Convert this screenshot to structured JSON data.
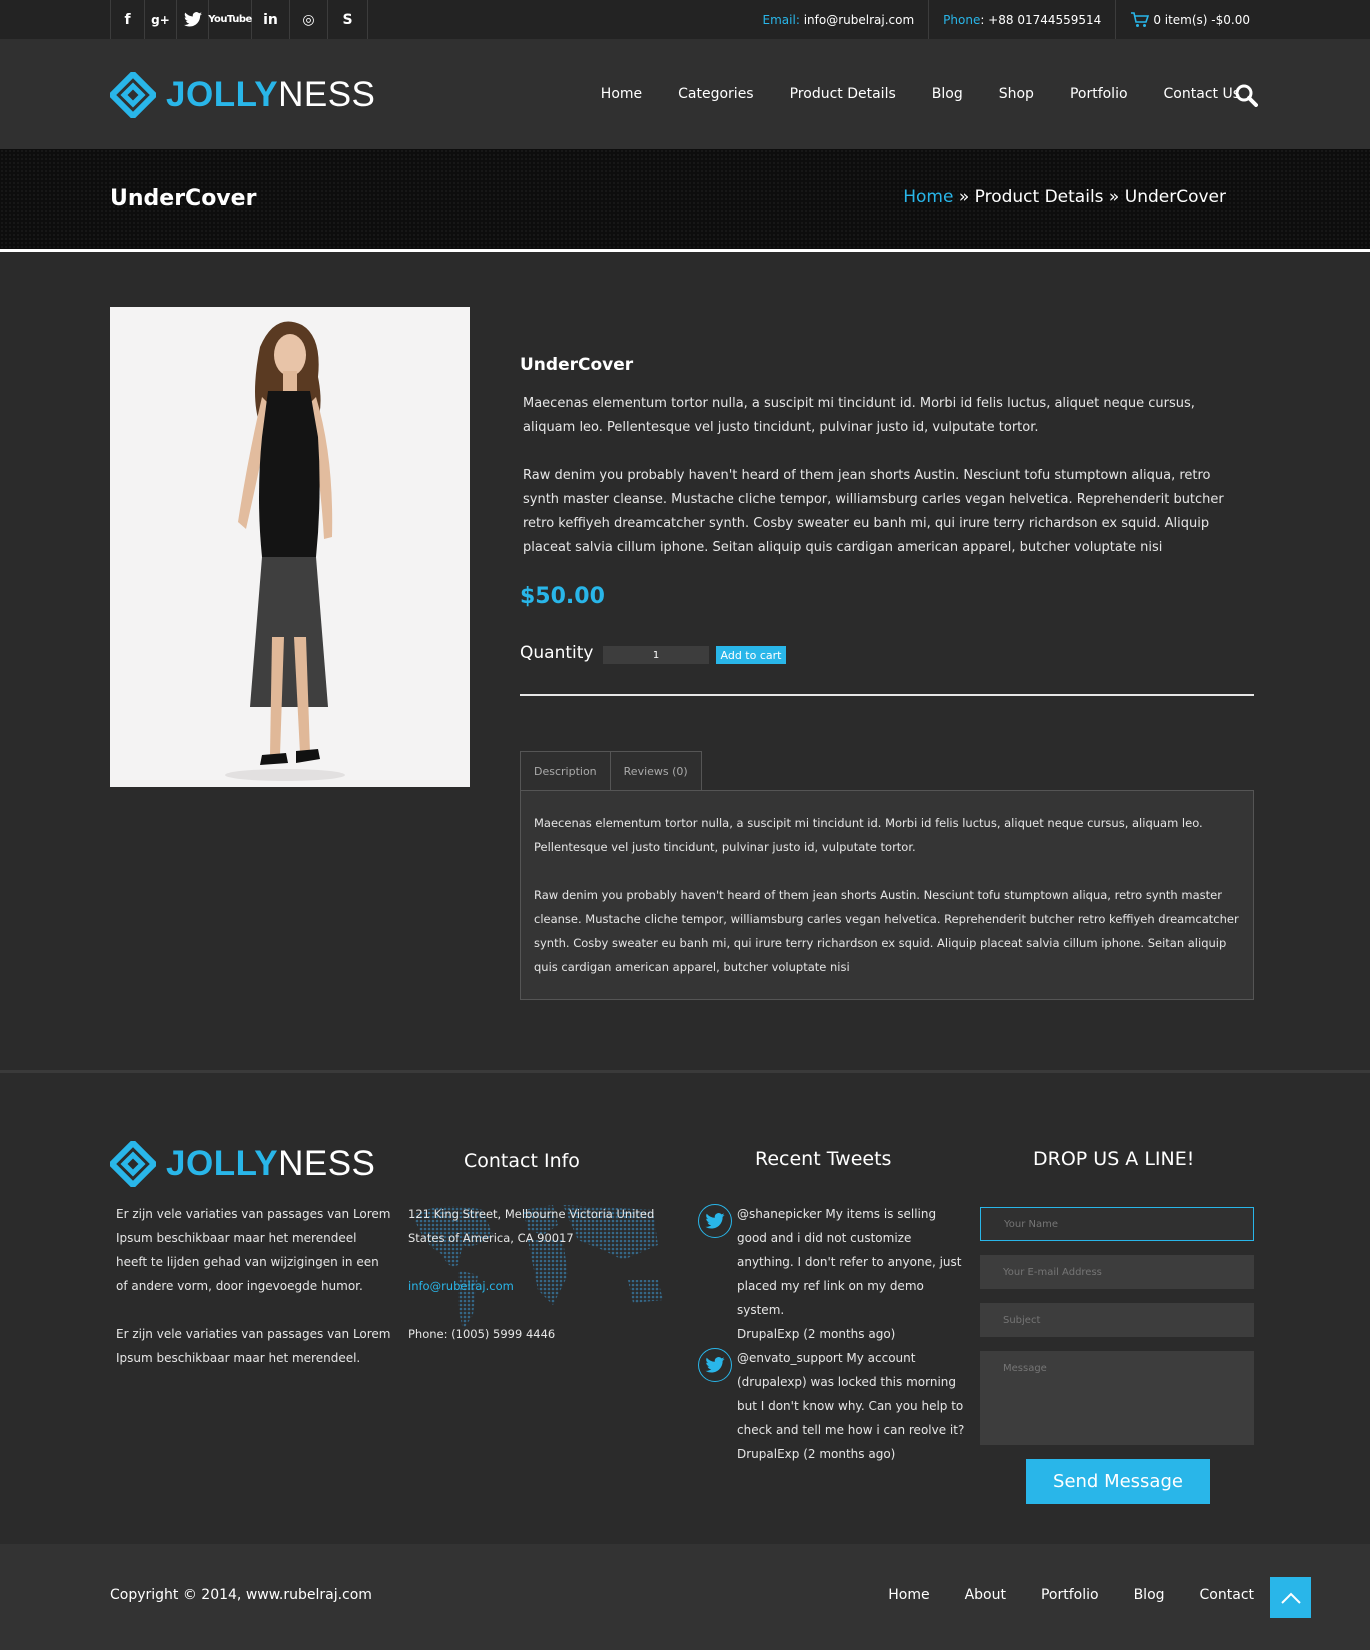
{
  "topbar": {
    "socials": [
      {
        "icon": "facebook-icon",
        "glyph": "f"
      },
      {
        "icon": "google-plus-icon",
        "glyph": "g+"
      },
      {
        "icon": "twitter-icon",
        "glyph": "t"
      },
      {
        "icon": "youtube-icon",
        "glyph": "YouTube"
      },
      {
        "icon": "linkedin-icon",
        "glyph": "in"
      },
      {
        "icon": "dribbble-icon",
        "glyph": "◎"
      },
      {
        "icon": "skype-icon",
        "glyph": "S"
      }
    ],
    "email_label": "Email:",
    "email_value": "info@rubelraj.com",
    "phone_label": "Phone",
    "phone_value": ": +88 01744559514",
    "cart_text": "0 item(s) -$0.00"
  },
  "header": {
    "logo_bold": "JOLLY",
    "logo_light": "NESS",
    "nav": [
      "Home",
      "Categories",
      "Product Details",
      "Blog",
      "Shop",
      "Portfolio",
      "Contact Us"
    ]
  },
  "banner": {
    "title": "UnderCover",
    "crumb_home": "Home",
    "crumb_sep1": " » ",
    "crumb_2": "Product Details",
    "crumb_sep2": " » ",
    "crumb_3": "UnderCover"
  },
  "product": {
    "title": "UnderCover",
    "desc_1": "Maecenas elementum tortor nulla, a suscipit mi tincidunt id. Morbi id felis luctus, aliquet neque cursus, aliquam leo. Pellentesque vel justo tincidunt, pulvinar justo id, vulputate tortor.",
    "desc_2": "Raw denim you probably haven't heard of them jean shorts Austin. Nesciunt tofu stumptown aliqua, retro synth master cleanse. Mustache cliche tempor, williamsburg carles vegan helvetica. Reprehenderit butcher retro keffiyeh dreamcatcher synth. Cosby sweater eu banh mi, qui irure terry richardson ex squid. Aliquip placeat salvia cillum iphone. Seitan aliquip quis cardigan american apparel, butcher voluptate nisi",
    "price": "$50.00",
    "quantity_label": "Quantity",
    "quantity_value": "1",
    "add_to_cart": "Add to cart"
  },
  "tabs": {
    "items": [
      "Description",
      "Reviews (0)"
    ],
    "active": "Description",
    "panel_1": "Maecenas elementum tortor nulla, a suscipit mi tincidunt id. Morbi id felis luctus, aliquet neque cursus, aliquam leo. Pellentesque vel justo tincidunt, pulvinar justo id, vulputate tortor.",
    "panel_2": "Raw denim you probably haven't heard of them jean shorts Austin. Nesciunt tofu stumptown aliqua, retro synth master cleanse. Mustache cliche tempor, williamsburg carles vegan helvetica. Reprehenderit butcher retro keffiyeh dreamcatcher synth. Cosby sweater eu banh mi, qui irure terry richardson ex squid. Aliquip placeat salvia cillum iphone. Seitan aliquip quis cardigan american apparel, butcher voluptate nisi"
  },
  "footer": {
    "about_1": "Er zijn vele variaties van passages van Lorem Ipsum beschikbaar maar het merendeel heeft te lijden gehad van wijzigingen in een of andere vorm, door ingevoegde humor.",
    "about_2": "Er zijn vele variaties van passages van Lorem Ipsum beschikbaar maar het merendeel.",
    "contact_heading": "Contact Info",
    "address": "121 King Street, Melbourne Victoria United States of America, CA 90017",
    "contact_email": "info@rubelraj.com",
    "contact_phone": "Phone: (1005) 5999 4446",
    "tweets_heading": "Recent Tweets",
    "tweets": [
      {
        "text": "@shanepicker My items is selling good and i did not customize anything. I don't refer to anyone, just placed my ref link on my demo system.",
        "meta": "DrupalExp (2 months ago)"
      },
      {
        "text": "@envato_support My account (drupalexp) was locked this morning but I don't know why. Can you help to check and tell me how i can reolve it?",
        "meta": "DrupalExp (2 months ago)"
      }
    ],
    "form_heading": "DROP US A LINE!",
    "name_placeholder": "Your Name",
    "email_placeholder": "Your E-mail Address",
    "subject_placeholder": "Subject",
    "message_placeholder": "Message",
    "send_label": "Send Message"
  },
  "bottom": {
    "copyright": "Copyright © 2014, www.rubelraj.com",
    "nav": [
      "Home",
      "About",
      "Portfolio",
      "Blog",
      "Contact"
    ]
  },
  "colors": {
    "accent": "#29b6e9",
    "background": "#2b2b2b",
    "banner": "#0d0d0d"
  }
}
